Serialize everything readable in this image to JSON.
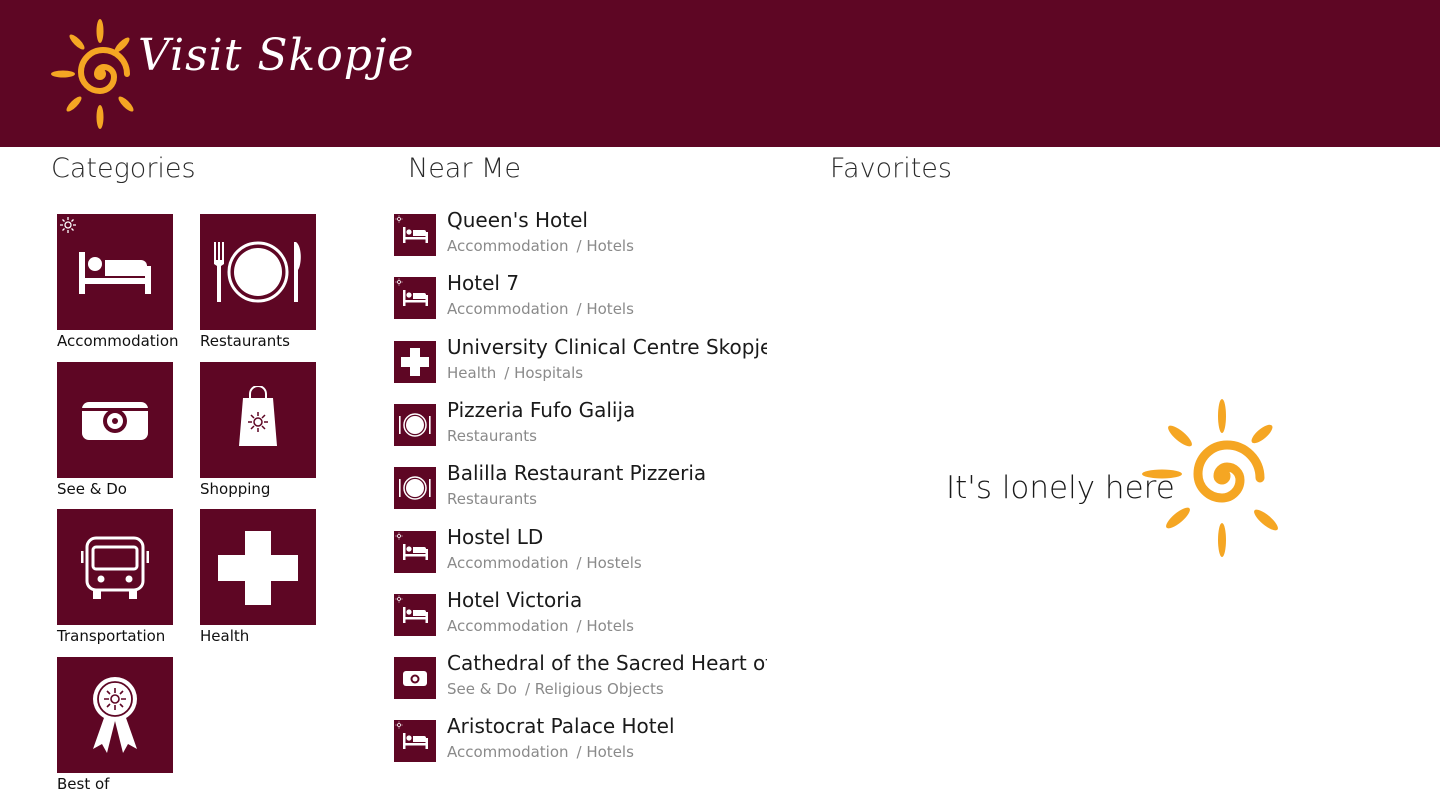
{
  "app": {
    "title": "Visit Skopje"
  },
  "colors": {
    "brand": "#5e0624",
    "sun": "#f5a623",
    "subtext": "#8a8a8a"
  },
  "sections": {
    "categories": "Categories",
    "near_me": "Near Me",
    "favorites": "Favorites"
  },
  "categories": [
    {
      "label": "Accommodation",
      "icon": "bed-icon"
    },
    {
      "label": "Restaurants",
      "icon": "plate-cutlery-icon"
    },
    {
      "label": "See & Do",
      "icon": "camera-icon"
    },
    {
      "label": "Shopping",
      "icon": "shopping-bag-icon"
    },
    {
      "label": "Transportation",
      "icon": "bus-icon"
    },
    {
      "label": "Health",
      "icon": "cross-icon"
    },
    {
      "label": "Best of",
      "icon": "award-ribbon-icon"
    }
  ],
  "near_me": [
    {
      "title": "Queen's Hotel",
      "category": "Accommodation",
      "subcategory": "/ Hotels",
      "icon": "bed-icon"
    },
    {
      "title": "Hotel 7",
      "category": "Accommodation",
      "subcategory": "/ Hotels",
      "icon": "bed-icon"
    },
    {
      "title": "University Clinical Centre Skopje",
      "category": "Health",
      "subcategory": "/ Hospitals",
      "icon": "cross-icon"
    },
    {
      "title": "Pizzeria Fufo Galija",
      "category": "Restaurants",
      "subcategory": "",
      "icon": "plate-cutlery-icon"
    },
    {
      "title": "Balilla Restaurant Pizzeria",
      "category": "Restaurants",
      "subcategory": "",
      "icon": "plate-cutlery-icon"
    },
    {
      "title": "Hostel LD",
      "category": "Accommodation",
      "subcategory": "/ Hostels",
      "icon": "bed-icon"
    },
    {
      "title": "Hotel Victoria",
      "category": "Accommodation",
      "subcategory": "/ Hotels",
      "icon": "bed-icon"
    },
    {
      "title": "Cathedral of the Sacred Heart of Jes",
      "category": "See & Do",
      "subcategory": "/ Religious Objects",
      "icon": "camera-icon"
    },
    {
      "title": "Aristocrat Palace Hotel",
      "category": "Accommodation",
      "subcategory": "/ Hotels",
      "icon": "bed-icon"
    }
  ],
  "favorites": {
    "empty_message": "It's lonely here",
    "icon": "sun-icon"
  }
}
